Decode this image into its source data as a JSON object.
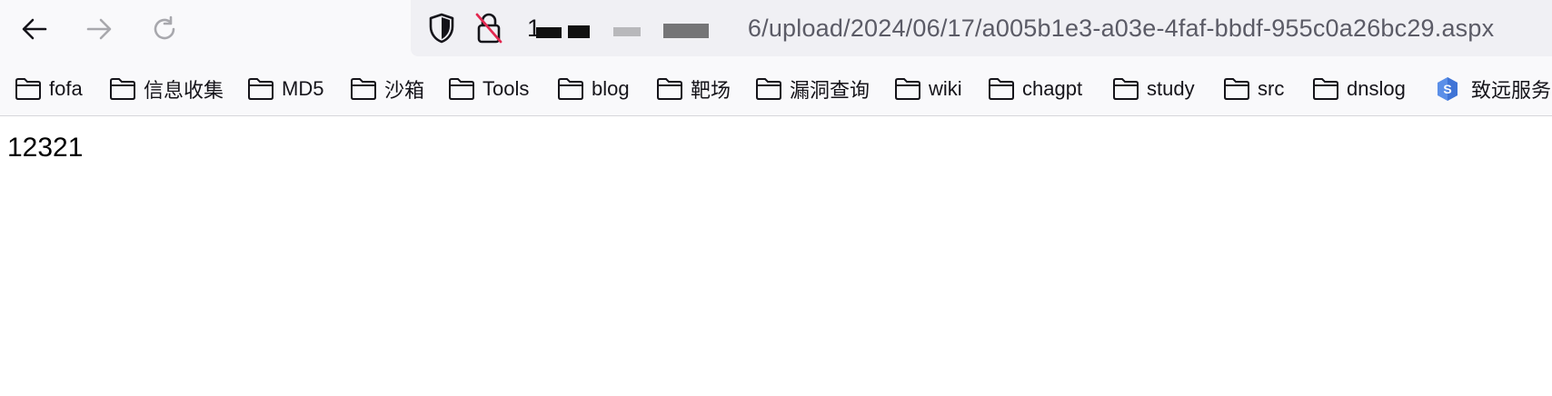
{
  "browser": {
    "nav": {
      "back_icon": "arrow-left-icon",
      "forward_icon": "arrow-right-icon",
      "reload_icon": "reload-icon"
    },
    "urlbar": {
      "shield_icon": "shield-icon",
      "lock_icon": "insecure-lock-icon",
      "url_host_visible": "1",
      "url_path": "6/upload/2024/06/17/a005b1e3-a03e-4faf-bbdf-955c0a26bc29.aspx"
    },
    "bookmarks": [
      {
        "label": "fofa",
        "icon": "folder-icon"
      },
      {
        "label": "信息收集",
        "icon": "folder-icon"
      },
      {
        "label": "MD5",
        "icon": "folder-icon"
      },
      {
        "label": "沙箱",
        "icon": "folder-icon"
      },
      {
        "label": "Tools",
        "icon": "folder-icon"
      },
      {
        "label": "blog",
        "icon": "folder-icon"
      },
      {
        "label": "靶场",
        "icon": "folder-icon"
      },
      {
        "label": "漏洞查询",
        "icon": "folder-icon"
      },
      {
        "label": "wiki",
        "icon": "folder-icon"
      },
      {
        "label": "chagpt",
        "icon": "folder-icon"
      },
      {
        "label": "study",
        "icon": "folder-icon"
      },
      {
        "label": "src",
        "icon": "folder-icon"
      },
      {
        "label": "dnslog",
        "icon": "folder-icon"
      },
      {
        "label": "致远服务",
        "icon": "seeyon-logo-icon"
      }
    ],
    "colors": {
      "toolbar_bg": "#f9f9fb",
      "urlbar_bg": "#f0f0f4",
      "insecure_red": "#e22850"
    }
  },
  "page": {
    "body_text": "12321"
  }
}
